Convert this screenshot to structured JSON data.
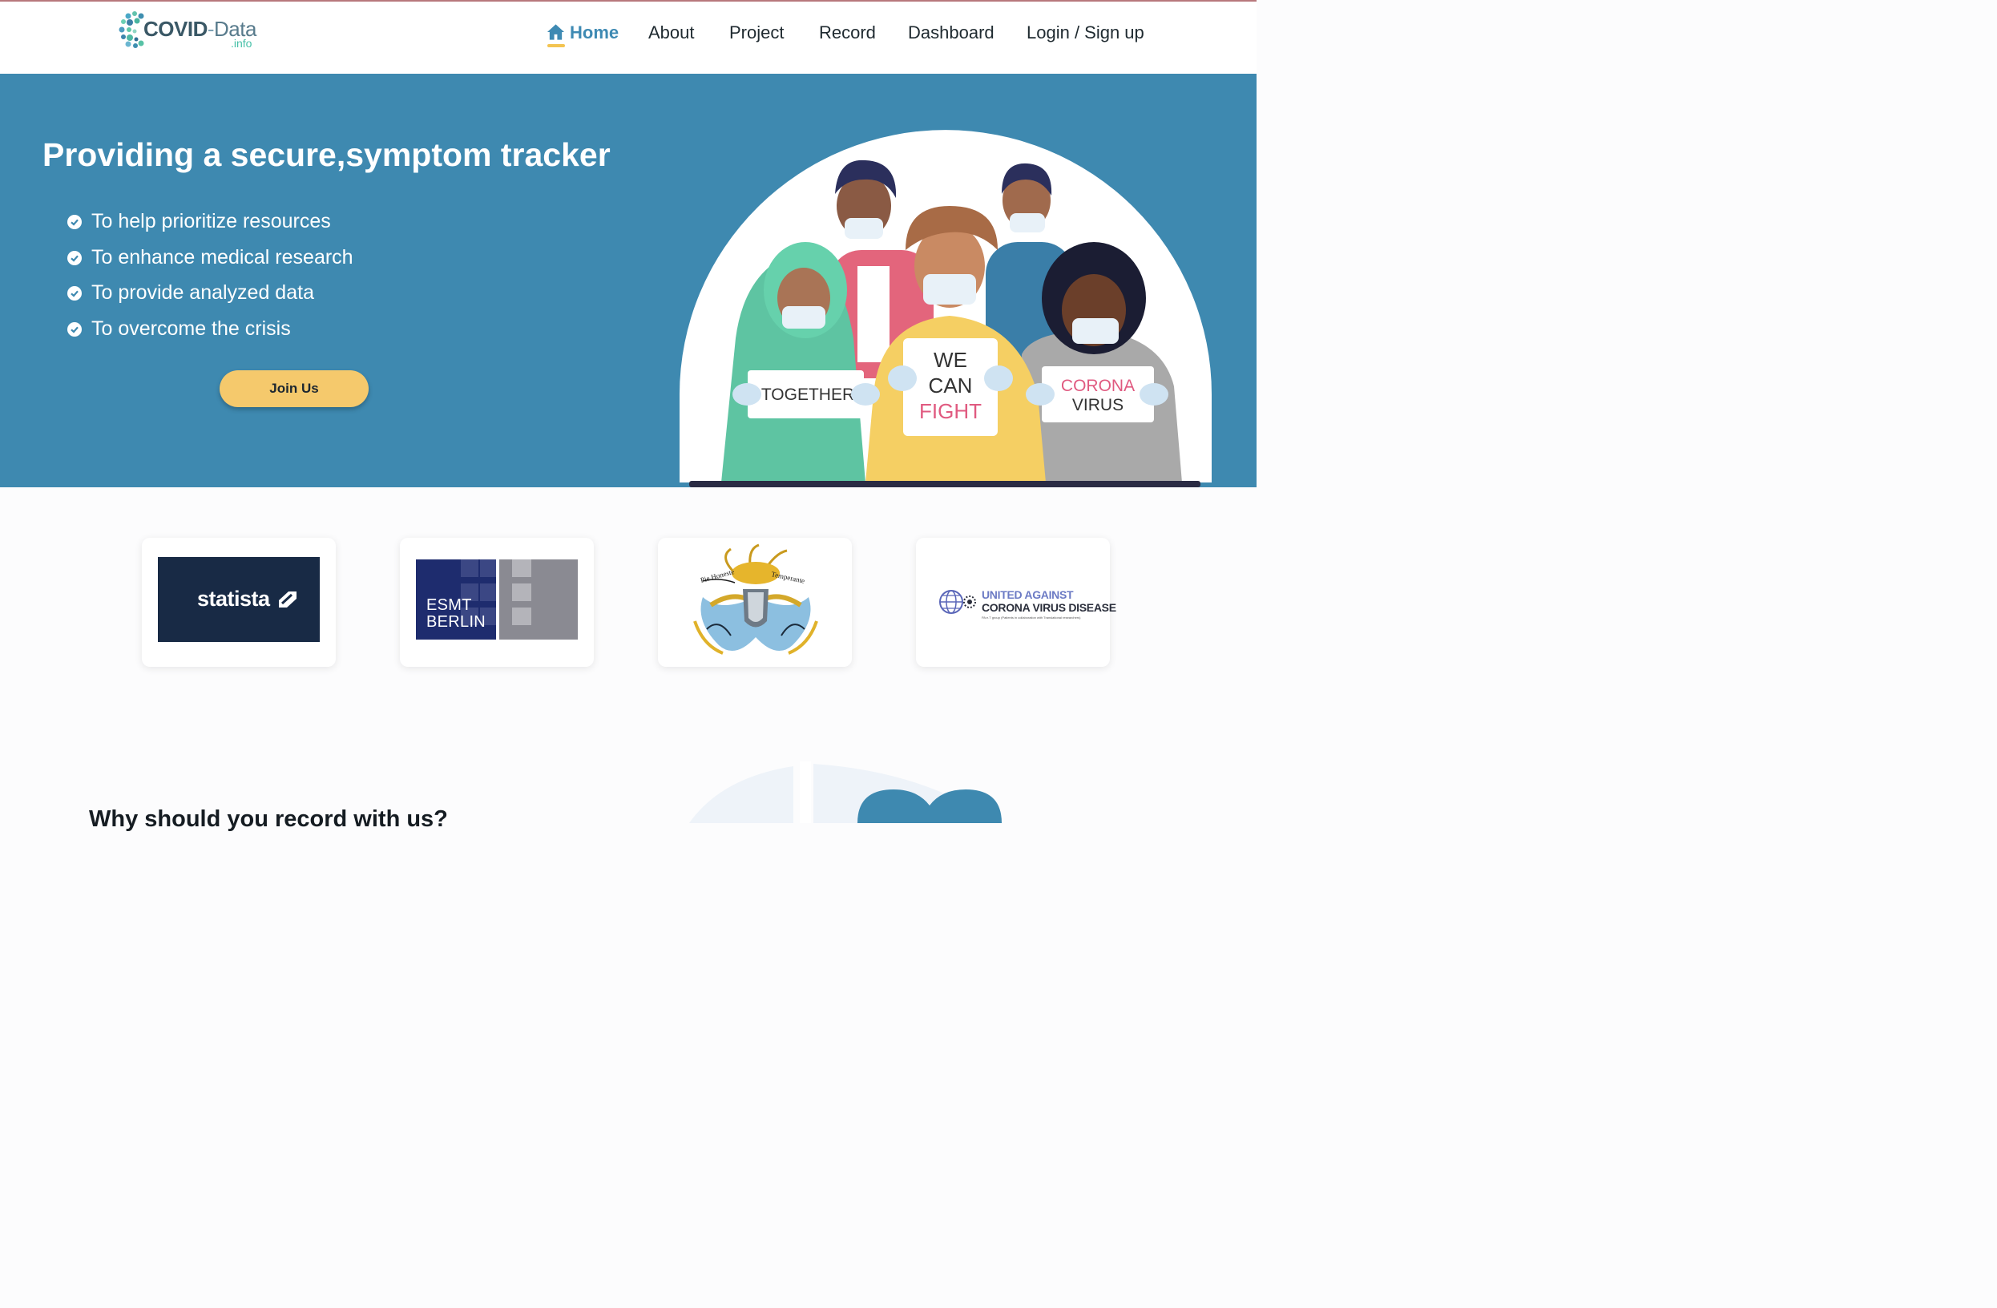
{
  "logo": {
    "brand": "COVID",
    "dash": "-",
    "brand_light": "Data",
    "sub": ".info"
  },
  "nav": {
    "items": [
      {
        "label": "Home",
        "active": true
      },
      {
        "label": "About"
      },
      {
        "label": "Project"
      },
      {
        "label": "Record"
      },
      {
        "label": "Dashboard"
      },
      {
        "label": "Login / Sign up"
      }
    ]
  },
  "hero": {
    "title": "Providing a secure,symptom tracker",
    "bullets": [
      "To help prioritize resources",
      "To enhance medical research",
      "To provide analyzed data",
      "To overcome the crisis"
    ],
    "cta_label": "Join Us",
    "illustration_signs": {
      "left": "TOGETHER",
      "center_1": "WE",
      "center_2": "CAN",
      "center_3": "FIGHT",
      "right_1": "CORONA",
      "right_2": "VIRUS"
    }
  },
  "partners": {
    "statista": "statista",
    "esmt_line1": "ESMT",
    "esmt_line2": "BERLIN",
    "crest_motto_left": "Pie Honeste",
    "crest_motto_right": "Temperante",
    "uacvd_line1": "UNITED AGAINST",
    "uacvd_line2": "CORONA VIRUS DISEASE",
    "uacvd_line3": "PA e.T group (Patients in collaboration with Translational researchers)"
  },
  "why": {
    "title": "Why should you record with us?"
  },
  "colors": {
    "hero_bg": "#3e89b0",
    "accent_yellow": "#f5c96c",
    "nav_active": "#3e8ab3",
    "statista_bg": "#182a45"
  },
  "icons": [
    "home-icon",
    "check-circle-icon",
    "logo-dots-icon",
    "statista-mark-icon",
    "globe-icon"
  ]
}
